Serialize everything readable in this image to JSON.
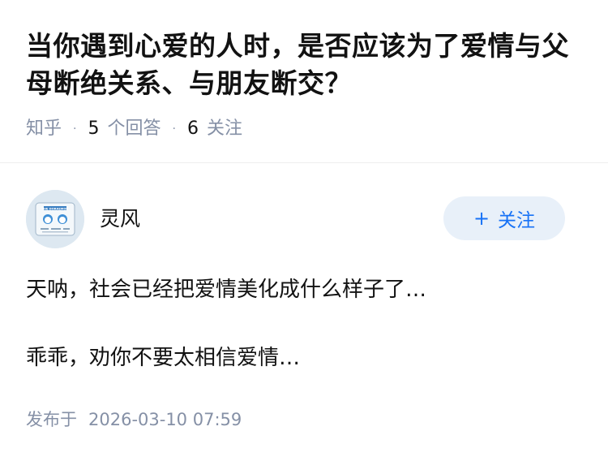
{
  "question": {
    "title": "当你遇到心爱的人时，是否应该为了爱情与父母断绝关系、与朋友断交？",
    "source": "知乎",
    "answer_count": "5",
    "answer_label": "个回答",
    "follow_count": "6",
    "follow_label": "关注"
  },
  "answer": {
    "author": {
      "name": "灵风",
      "avatar_caption": "THE DORAEMON",
      "follow_button": "关注",
      "follow_icon": "plus-icon"
    },
    "paragraphs": [
      "天呐，社会已经把爱情美化成什么样子了…",
      "乖乖，劝你不要太相信爱情…"
    ],
    "published_label": "发布于",
    "published_time": "2026-03-10 07:59"
  },
  "colors": {
    "accent": "#1772f6",
    "follow_bg": "#e8f0f9",
    "meta": "#8590a6",
    "text": "#121212"
  }
}
